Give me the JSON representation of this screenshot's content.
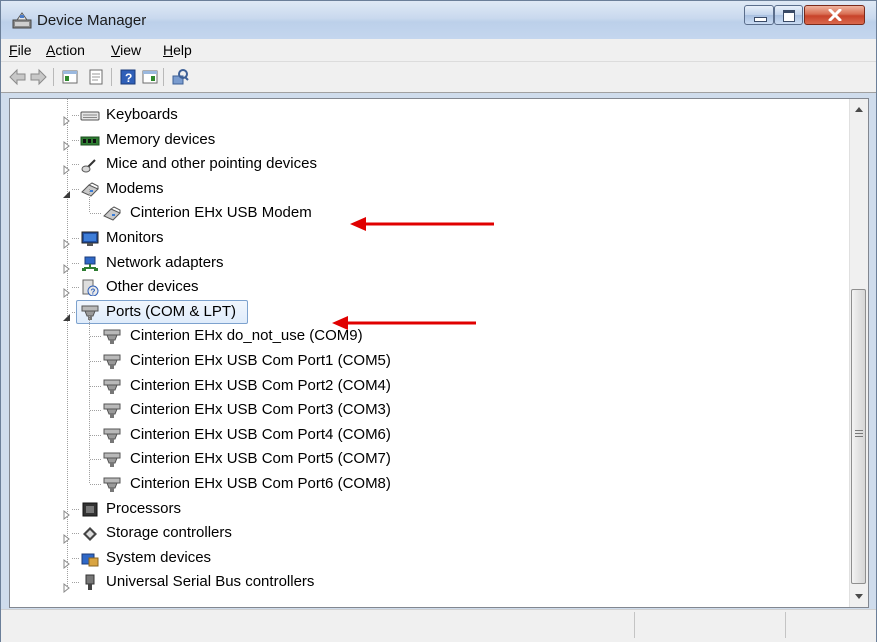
{
  "window": {
    "title": "Device Manager"
  },
  "menu": [
    "File",
    "Action",
    "View",
    "Help"
  ],
  "menu_hotkeys": [
    "F",
    "A",
    "V",
    "H"
  ],
  "toolbar": [
    "back-icon",
    "forward-icon",
    "properties-icon",
    "show-hide-tree-icon",
    "help-icon",
    "update-driver-icon",
    "scan-hardware-icon"
  ],
  "tree": {
    "items": [
      {
        "label": "Keyboards",
        "icon": "keyboard-icon",
        "expanded": false
      },
      {
        "label": "Memory devices",
        "icon": "memory-icon",
        "expanded": false
      },
      {
        "label": "Mice and other pointing devices",
        "icon": "mouse-icon",
        "expanded": false
      },
      {
        "label": "Modems",
        "icon": "modem-icon",
        "expanded": true
      },
      {
        "label": "Cinterion EHx USB Modem",
        "icon": "modem-icon",
        "child": true
      },
      {
        "label": "Monitors",
        "icon": "monitor-icon",
        "expanded": false
      },
      {
        "label": "Network adapters",
        "icon": "network-icon",
        "expanded": false
      },
      {
        "label": "Other devices",
        "icon": "unknown-device-icon",
        "expanded": false
      },
      {
        "label": "Ports (COM & LPT)",
        "icon": "port-icon",
        "expanded": true,
        "selected": true
      },
      {
        "label": "Cinterion EHx do_not_use (COM9)",
        "icon": "port-icon",
        "child": true
      },
      {
        "label": "Cinterion EHx USB Com Port1 (COM5)",
        "icon": "port-icon",
        "child": true
      },
      {
        "label": "Cinterion EHx USB Com Port2 (COM4)",
        "icon": "port-icon",
        "child": true
      },
      {
        "label": "Cinterion EHx USB Com Port3 (COM3)",
        "icon": "port-icon",
        "child": true
      },
      {
        "label": "Cinterion EHx USB Com Port4 (COM6)",
        "icon": "port-icon",
        "child": true
      },
      {
        "label": "Cinterion EHx USB Com Port5 (COM7)",
        "icon": "port-icon",
        "child": true
      },
      {
        "label": "Cinterion EHx USB Com Port6 (COM8)",
        "icon": "port-icon",
        "child": true
      },
      {
        "label": "Processors",
        "icon": "processor-icon",
        "expanded": false
      },
      {
        "label": "Storage controllers",
        "icon": "storage-icon",
        "expanded": false
      },
      {
        "label": "System devices",
        "icon": "system-icon",
        "expanded": false
      },
      {
        "label": "Universal Serial Bus controllers",
        "icon": "usb-icon",
        "expanded": false
      }
    ]
  },
  "annotations": {
    "arrow_color": "#e00000"
  },
  "colors": {
    "selection_border": "#7da2ce",
    "title_bar": "#c9d9ee",
    "close_button": "#c8432a"
  }
}
